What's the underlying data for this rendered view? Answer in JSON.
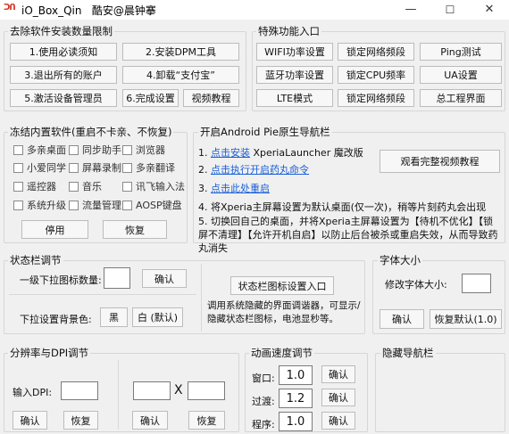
{
  "window": {
    "icon_text": "ᑐᑎ",
    "title": "iO_Box_Qin   酷安@晨钟搴",
    "min_glyph": "—",
    "max_glyph": "☐",
    "close_glyph": "✕"
  },
  "limits": {
    "title": "去除软件安装数量限制",
    "b1": "1.使用必读须知",
    "b2": "2.安装DPM工具",
    "b3": "3.退出所有的账户",
    "b4": "4.卸载“支付宝”",
    "b5": "5.激活设备管理员",
    "b6": "6.完成设置",
    "b7": "视频教程"
  },
  "special": {
    "title": "特殊功能入口",
    "buttons": [
      "WIFI功率设置",
      "锁定网络频段",
      "Ping测试",
      "蓝牙功率设置",
      "锁定CPU频率",
      "UA设置",
      "LTE模式",
      "锁定网络频段",
      "总工程界面"
    ]
  },
  "freeze": {
    "title": "冻结内置软件(重启不卡亲、不恢复)",
    "items": [
      "多亲桌面",
      "同步助手",
      "浏览器",
      "小爱同学",
      "屏幕录制",
      "多亲翻译",
      "遥控器",
      "音乐",
      "讯飞输入法",
      "系统升级",
      "流量管理",
      "AOSP键盘"
    ],
    "disable": "停用",
    "restore": "恢复"
  },
  "pie": {
    "title": "开启Android Pie原生导航栏",
    "s1_num": "1.",
    "s1_link": "点击安装",
    "s1_text": "XperiaLauncher 魔改版",
    "s2_num": "2.",
    "s2_link": "点击执行开启药丸命令",
    "s3_num": "3.",
    "s3_link": "点击此处重启",
    "s4": "4. 将Xperia主屏幕设置为默认桌面(仅一次)，稍等片刻药丸会出现",
    "s5": "5. 切换回自己的桌面，并将Xperia主屏幕设置为【待机不优化】【锁屏不清理】【允许开机自启】以防止后台被杀或重启失效，从而导致药丸消失",
    "video": "观看完整视频教程"
  },
  "statusbar": {
    "title": "状态栏调节",
    "level_label": "一级下拉图标数量:",
    "confirm": "确认",
    "icon_entry": "状态栏图标设置入口",
    "desc": "调用系统隐藏的界面调谐器，可显示/隐藏状态栏图标，电池显秒等。",
    "bg_label": "下拉设置背景色:",
    "black": "黑",
    "white": "白 (默认)"
  },
  "font": {
    "title": "字体大小",
    "label": "修改字体大小:",
    "confirm": "确认",
    "reset": "恢复默认(1.0)"
  },
  "dpi": {
    "title": "分辨率与DPI调节",
    "input_label": "输入DPI:",
    "x": "X",
    "confirm1": "确认",
    "restore1": "恢复",
    "confirm2": "确认",
    "restore2": "恢复"
  },
  "anim": {
    "title": "动画速度调节",
    "window_label": "窗口:",
    "window_val": "1.0",
    "trans_label": "过渡:",
    "trans_val": "1.2",
    "prog_label": "程序:",
    "prog_val": "1.0",
    "confirm": "确认"
  },
  "hidenav": {
    "title": "隐藏导航栏"
  }
}
